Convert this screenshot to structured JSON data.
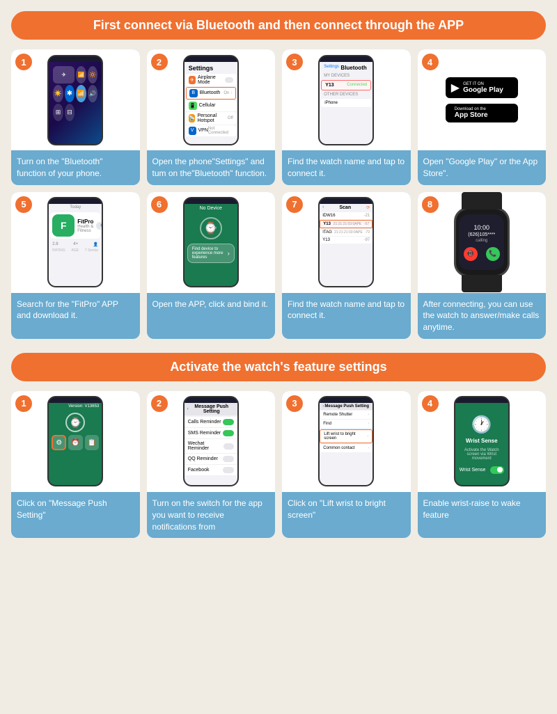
{
  "section1": {
    "title": "First connect via Bluetooth and then connect through the APP"
  },
  "section2": {
    "title": "Activate the watch's feature settings"
  },
  "steps": [
    {
      "number": "1",
      "description": "Turn on the \"Bluetooth\" function of your phone."
    },
    {
      "number": "2",
      "description": "Open the phone\"Settings\" and tum on the\"Bluetooth\" function."
    },
    {
      "number": "3",
      "description": "Find the watch name and tap to connect it."
    },
    {
      "number": "4",
      "description": "Open \"Google Play\" or the App Store\"."
    },
    {
      "number": "5",
      "description": "Search for the \"FitPro\" APP and download it."
    },
    {
      "number": "6",
      "description": "Open the APP, click and bind it."
    },
    {
      "number": "7",
      "description": "Find the watch name and tap to connect it."
    },
    {
      "number": "8",
      "description": "After connecting, you can use the watch to answer/make calls anytime."
    }
  ],
  "steps2": [
    {
      "number": "1",
      "description": "Click on \"Message Push Setting\""
    },
    {
      "number": "2",
      "description": "Turn on the switch for the app you want to receive notifications from"
    },
    {
      "number": "3",
      "description": "Click on \"Lift wrist to bright screen\""
    },
    {
      "number": "4",
      "description": "Enable wrist-raise to wake feature"
    }
  ],
  "settings": {
    "title": "Settings",
    "bluetooth": "Bluetooth",
    "bluetooth_state": "On",
    "airplane": "Airplane Mode",
    "cellular": "Cellular",
    "hotspot": "Personal Hotspot",
    "vpn": "VPN",
    "vpn_state": "Not Connected"
  },
  "bluetooth_screen": {
    "title": "Bluetooth",
    "device": "Y13",
    "back": "Settings"
  },
  "appstore": {
    "google_play_small": "GET IT ON",
    "google_play_big": "Google Play",
    "appstore_small": "Download on the",
    "appstore_big": "App Store"
  },
  "fitpro": {
    "name": "FitPro",
    "version": "Version: V13653",
    "bind_text": "Find device to experience more features",
    "no_device": "No Device"
  },
  "scan": {
    "title": "Scan",
    "device1": "IDW16",
    "device1_signal": "-21",
    "device2": "Y13",
    "device2_id": "21:21:21:03:0APE",
    "device2_signal": "-57",
    "device3": "ITAG",
    "device3_id": "21:21:21:03:0APE",
    "device3_signal": "-72",
    "device4": "Y13",
    "device4_signal": "-97"
  },
  "watch_call": {
    "number": "(626)105****",
    "time": "10:00",
    "label": "calling"
  },
  "msg_push": {
    "title": "Message Push Setting",
    "calls": "Calls Reminder",
    "sms": "SMS Reminder",
    "wechat": "Wechat Reminder",
    "qq": "QQ Reminder",
    "facebook": "Facebook"
  },
  "lift_screen": {
    "title": "Message Push Setting",
    "remote_shutter": "Remote Shutter",
    "find": "Find",
    "lift_wrist": "Lift wrist to bright screen",
    "common_contact": "Common contact"
  },
  "wrist_sense": {
    "label": "Wrist Sense",
    "activate_text": "Activate the Watch screen via Wrist movement"
  }
}
